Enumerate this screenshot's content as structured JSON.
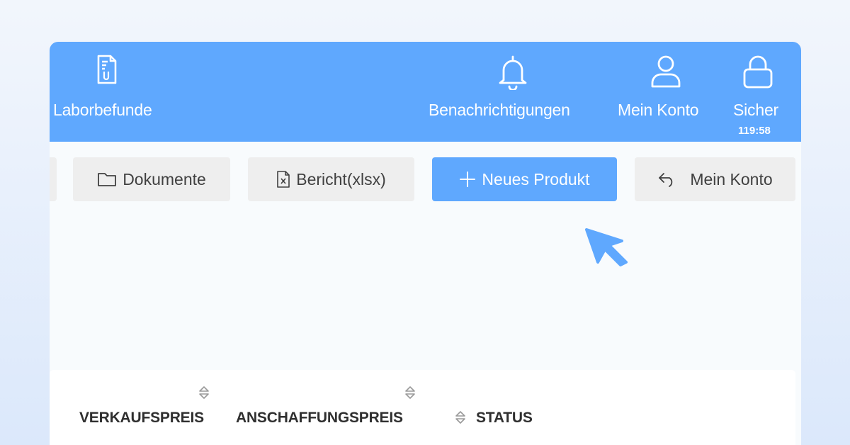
{
  "topbar": {
    "items": [
      {
        "label": "Laborbefunde",
        "icon": "lab-report-icon"
      },
      {
        "label": "Benachrichtigungen",
        "icon": "bell-icon"
      },
      {
        "label": "Mein Konto",
        "icon": "user-icon"
      },
      {
        "label": "Sicher",
        "icon": "lock-icon",
        "timer": "119:58"
      }
    ]
  },
  "toolbar": {
    "buttons": [
      {
        "label": "Dokumente",
        "icon": "folder-icon"
      },
      {
        "label": "Bericht(xlsx)",
        "icon": "excel-file-icon"
      },
      {
        "label": "Neues Produkt",
        "icon": "plus-icon"
      },
      {
        "label": "Mein Konto",
        "icon": "reply-icon"
      }
    ]
  },
  "table": {
    "columns": [
      {
        "label": "VERKAUFSPREIS"
      },
      {
        "label": "ANSCHAFFUNGSPREIS"
      },
      {
        "label": "STATUS"
      }
    ]
  },
  "colors": {
    "accent": "#5fa8fe",
    "button_bg": "#eeeeee",
    "page_bg": "#f8fbfd"
  }
}
